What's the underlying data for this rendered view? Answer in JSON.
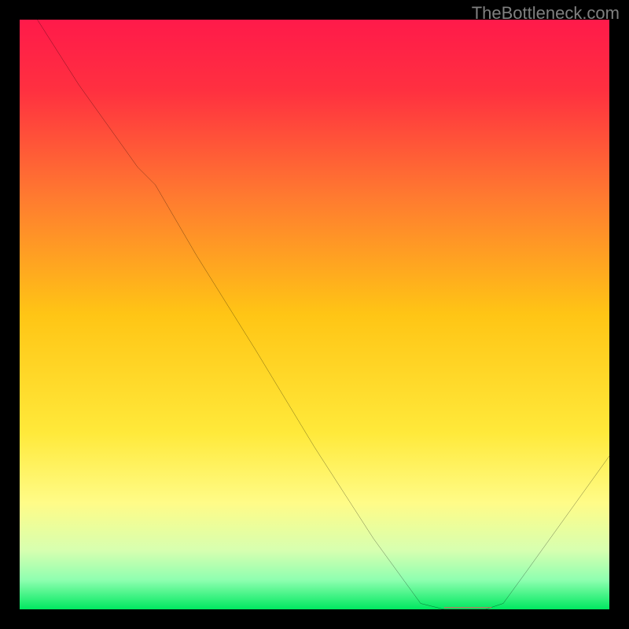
{
  "watermark": "TheBottleneck.com",
  "chart_data": {
    "type": "line",
    "title": "",
    "xlabel": "",
    "ylabel": "",
    "xlim": [
      0,
      100
    ],
    "ylim": [
      0,
      100
    ],
    "grid": false,
    "curve": {
      "x": [
        3,
        10,
        20,
        23,
        30,
        40,
        50,
        60,
        68,
        72,
        79,
        82,
        86,
        100
      ],
      "y": [
        100,
        89,
        75,
        72,
        60,
        44,
        27.5,
        12,
        1,
        0,
        0,
        1,
        6.5,
        26
      ],
      "description": "Black bottleneck curve: steep descent from top-left, slight slope change around x≈23 (knee), near-linear drop to minimum plateau around x≈72–79, then rises toward right edge."
    },
    "optimum_marker": {
      "x_start": 72,
      "x_end": 80,
      "y": 0.3,
      "color": "#e06060",
      "description": "Short horizontal red segment marking the optimal (minimum-bottleneck) region."
    },
    "gradient": {
      "direction": "vertical",
      "stops": [
        {
          "offset": 0.0,
          "color": "#ff1a4a"
        },
        {
          "offset": 0.12,
          "color": "#ff3040"
        },
        {
          "offset": 0.3,
          "color": "#ff7a30"
        },
        {
          "offset": 0.5,
          "color": "#ffc515"
        },
        {
          "offset": 0.7,
          "color": "#ffe93a"
        },
        {
          "offset": 0.82,
          "color": "#fffc88"
        },
        {
          "offset": 0.9,
          "color": "#d7ffb0"
        },
        {
          "offset": 0.95,
          "color": "#8fffb0"
        },
        {
          "offset": 1.0,
          "color": "#00e860"
        }
      ]
    }
  }
}
